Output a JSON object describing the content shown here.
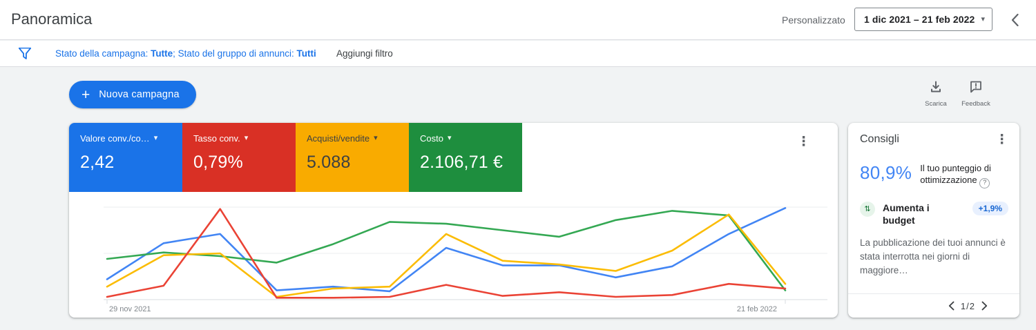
{
  "header": {
    "title": "Panoramica",
    "date_preset": "Personalizzato",
    "date_range": "1 dic 2021 – 21 feb 2022"
  },
  "filter_bar": {
    "campaign_status_label": "Stato della campagna:",
    "campaign_status_value": "Tutte",
    "separator": ";",
    "adgroup_status_label": "Stato del gruppo di annunci:",
    "adgroup_status_value": "Tutti",
    "add_filter_label": "Aggiungi filtro"
  },
  "toolbar": {
    "new_campaign_label": "Nuova campagna",
    "download_label": "Scarica",
    "feedback_label": "Feedback"
  },
  "metrics": [
    {
      "label": "Valore conv./co…",
      "value": "2,42",
      "color": "#1a73e8",
      "text_color": "#ffffff"
    },
    {
      "label": "Tasso conv.",
      "value": "0,79%",
      "color": "#d93025",
      "text_color": "#ffffff"
    },
    {
      "label": "Acquisti/vendite",
      "value": "5.088",
      "color": "#f9ab00",
      "text_color": "#3c4043"
    },
    {
      "label": "Costo",
      "value": "2.106,71 €",
      "color": "#1e8e3e",
      "text_color": "#ffffff"
    }
  ],
  "chart_data": {
    "type": "line",
    "title": "",
    "xlabel": "",
    "ylabel": "",
    "x_tick_labels_visible": [
      "29 nov 2021",
      "21 feb 2022"
    ],
    "points_per_series": 13,
    "ylim": [
      0,
      100
    ],
    "grid": true,
    "legend_position": "none",
    "series": [
      {
        "name": "Valore conv./co…",
        "color": "#4285f4",
        "values": [
          22,
          61,
          71,
          10,
          14,
          9,
          56,
          37,
          37,
          24,
          36,
          71,
          99
        ]
      },
      {
        "name": "Tasso conv.",
        "color": "#ea4335",
        "values": [
          3,
          15,
          98,
          2,
          2,
          3,
          16,
          4,
          8,
          3,
          5,
          17,
          12
        ]
      },
      {
        "name": "Acquisti/vendite",
        "color": "#fbbc04",
        "values": [
          14,
          48,
          50,
          3,
          12,
          14,
          71,
          42,
          38,
          31,
          53,
          92,
          17
        ]
      },
      {
        "name": "Costo",
        "color": "#34a853",
        "values": [
          44,
          51,
          47,
          40,
          60,
          84,
          82,
          75,
          68,
          86,
          96,
          91,
          10
        ]
      }
    ]
  },
  "recommendations": {
    "title": "Consigli",
    "score": {
      "value": "80,9%",
      "label": "Il tuo punteggio di ottimizzazione"
    },
    "item": {
      "title": "Aumenta i budget",
      "uplift": "+1,9%",
      "description": "La pubblicazione dei tuoi annunci è stata interrotta nei giorni di maggiore…"
    },
    "pagination": {
      "current": "1/2"
    }
  },
  "icons": {
    "kebab": "⋮",
    "caret_down": "▾",
    "budget_arrows": "⇅",
    "help": "?",
    "plus": "+"
  }
}
